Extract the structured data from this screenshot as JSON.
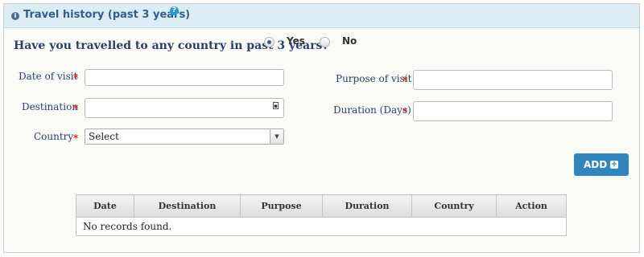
{
  "header": {
    "title": "Travel history (past 3 years)",
    "info_icon": "info-circle-icon",
    "help_icon": "question-circle-icon"
  },
  "question": {
    "text": "Have you travelled to any country in past 3 years?",
    "options": [
      {
        "label": "Yes",
        "checked": true
      },
      {
        "label": "No",
        "checked": false
      }
    ]
  },
  "fields": {
    "date_of_visit": {
      "label": "Date of visit",
      "value": ""
    },
    "destination": {
      "label": "Destination",
      "value": ""
    },
    "country": {
      "label": "Country",
      "selected": "Select"
    },
    "purpose_of_visit": {
      "label": "Purpose of visit",
      "value": ""
    },
    "duration_days": {
      "label": "Duration (Days)",
      "value": ""
    },
    "required_marker": "*"
  },
  "add_button": {
    "label": "ADD",
    "icon": "plus-square-icon"
  },
  "table": {
    "columns": [
      "Date",
      "Destination",
      "Purpose",
      "Duration",
      "Country",
      "Action"
    ],
    "empty_text": "No records found."
  },
  "colors": {
    "header_bg": "#dcecf5",
    "title": "#2c5f8e",
    "button": "#2f86bf",
    "required": "#e02a2a"
  }
}
